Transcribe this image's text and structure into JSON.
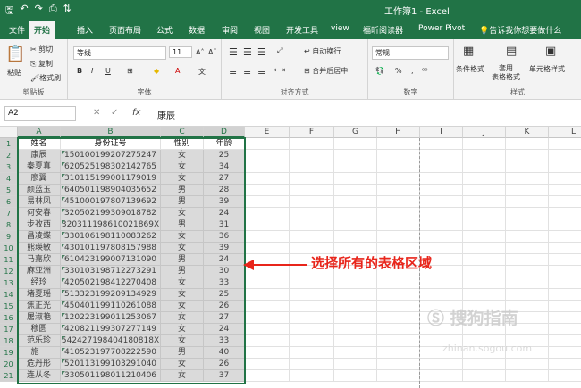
{
  "window": {
    "title": "工作簿1 - Excel"
  },
  "qat": {
    "save": "🖫",
    "undo": "↶",
    "redo": "↷",
    "print": "⎙",
    "sort": "⇅"
  },
  "tabs": [
    "文件",
    "开始",
    "插入",
    "页面布局",
    "公式",
    "数据",
    "审阅",
    "视图",
    "开发工具",
    "view",
    "福昕阅读器",
    "Power Pivot",
    "告诉我你想要做什么"
  ],
  "ribbon": {
    "clipboard": {
      "paste": "粘贴",
      "cut": "剪切",
      "copy": "复制",
      "format_painter": "格式刷",
      "label": "剪贴板"
    },
    "font": {
      "name": "等线",
      "size": "11",
      "grow": "A˄",
      "shrink": "A˅",
      "bold": "B",
      "italic": "I",
      "underline": "U",
      "label": "字体"
    },
    "alignment": {
      "wrap": "自动换行",
      "merge": "合并后居中",
      "label": "对齐方式"
    },
    "number": {
      "format": "常规",
      "percent": "%",
      "comma": ",",
      "label": "数字"
    },
    "styles": {
      "conditional": "条件格式",
      "table": "套用\n表格格式",
      "cell_styles": "单元格样式",
      "label": "样式"
    }
  },
  "formula_bar": {
    "name_box": "A2",
    "fx": "fx",
    "content": "康辰"
  },
  "columns": [
    "A",
    "B",
    "C",
    "D",
    "E",
    "F",
    "G",
    "H",
    "I",
    "J",
    "K",
    "L"
  ],
  "rows": [
    "1",
    "2",
    "3",
    "4",
    "5",
    "6",
    "7",
    "8",
    "9",
    "10",
    "11",
    "12",
    "13",
    "14",
    "15",
    "16",
    "17",
    "18",
    "19",
    "20",
    "21"
  ],
  "table": {
    "headers": [
      "姓名",
      "身份证号",
      "性别",
      "年龄"
    ],
    "data": [
      [
        "康辰",
        "150100199207275247",
        "女",
        "25"
      ],
      [
        "秦夏真",
        "620525198302142765",
        "女",
        "34"
      ],
      [
        "廖翼",
        "310115199001179019",
        "女",
        "27"
      ],
      [
        "颜蓝玉",
        "640501198904035652",
        "男",
        "28"
      ],
      [
        "易林凤",
        "451000197807139692",
        "男",
        "39"
      ],
      [
        "何安春",
        "320502199309018782",
        "女",
        "24"
      ],
      [
        "步孜西",
        "320311198610021869X",
        "男",
        "31"
      ],
      [
        "昌凌蝶",
        "330106198110083262",
        "女",
        "36"
      ],
      [
        "熊瑛敏",
        "430101197808157988",
        "女",
        "39"
      ],
      [
        "马嘉欣",
        "610423199007131090",
        "男",
        "24"
      ],
      [
        "麻亚洲",
        "330103198712273291",
        "男",
        "30"
      ],
      [
        "经玲",
        "420502198412270408",
        "女",
        "33"
      ],
      [
        "堵夏瑶",
        "513323199209134929",
        "女",
        "25"
      ],
      [
        "焦正光",
        "450401199110261088",
        "女",
        "26"
      ],
      [
        "屠淑艳",
        "120223199011253067",
        "女",
        "27"
      ],
      [
        "穆圆",
        "420821199307277149",
        "女",
        "24"
      ],
      [
        "范乐珍",
        "542427198404180818X",
        "女",
        "33"
      ],
      [
        "施一",
        "410523197708222590",
        "男",
        "40"
      ],
      [
        "危丹彤",
        "520113199103291040",
        "女",
        "26"
      ],
      [
        "连从冬",
        "330501198011210406",
        "女",
        "37"
      ]
    ]
  },
  "annotation": "选择所有的表格区域",
  "watermark": {
    "main": "搜狗指南",
    "sub": "zhinan.sogou.com"
  },
  "colors": {
    "accent": "#217346",
    "annotation": "#e8251b"
  }
}
